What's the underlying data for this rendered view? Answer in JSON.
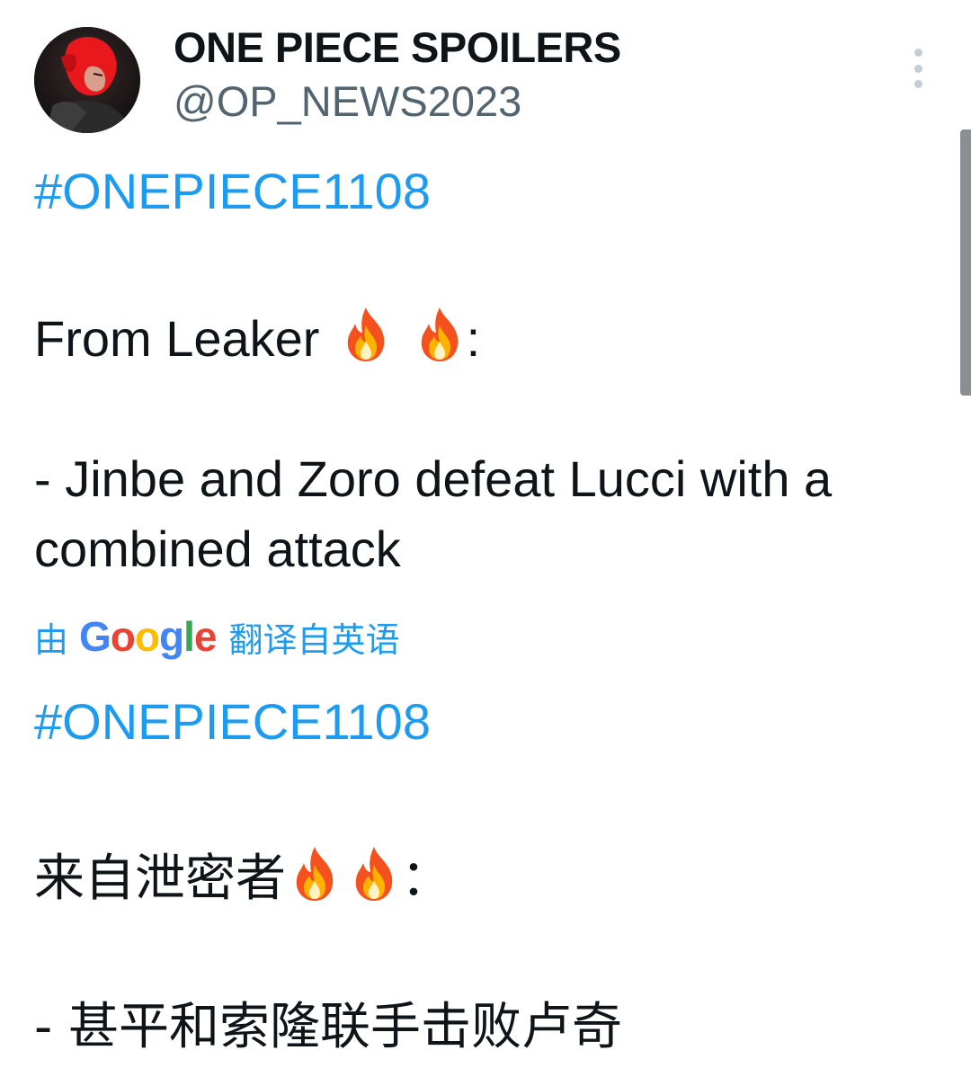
{
  "author": {
    "name": "ONE PIECE SPOILERS",
    "handle": "@OP_NEWS2023"
  },
  "icons": {
    "avatar": "avatar-image",
    "more": "vertical-ellipsis-icon",
    "emoji": "fire-emoji"
  },
  "tweet": {
    "hashtag": "#ONEPIECE1108",
    "intro_text": "From Leaker",
    "intro_colon": ":",
    "body_line_1": "- Jinbe and Zoro defeat Lucci with a",
    "body_line_2": "combined attack"
  },
  "translation_notice": {
    "prefix": "由",
    "logo_text": "Google",
    "suffix": "翻译自英语"
  },
  "translation": {
    "hashtag": "#ONEPIECE1108",
    "intro_text": "来自泄密者",
    "intro_colon": "：",
    "body_line_1": "- 甚平和索隆联手击败卢奇"
  },
  "colors": {
    "link": "#1d9bf0",
    "text": "#0f1419",
    "secondary": "#536471"
  }
}
